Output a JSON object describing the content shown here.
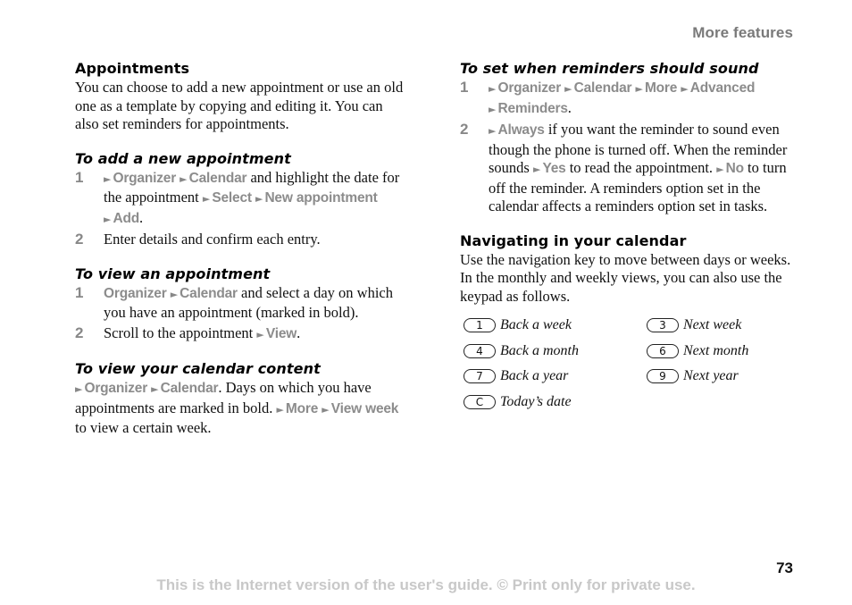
{
  "header": {
    "section_title": "More features"
  },
  "left": {
    "appointments": {
      "heading": "Appointments",
      "body": "You can choose to add a new appointment or use an old one as a template by copying and editing it. You can also set reminders for appointments."
    },
    "add_new": {
      "heading": "To add a new appointment",
      "steps": [
        {
          "num": "1",
          "m1": "Organizer",
          "m2": "Calendar",
          "t1": " and highlight the date for the appointment ",
          "m3": "Select",
          "m4": "New appointment",
          "m5": "Add",
          "t2": "."
        },
        {
          "num": "2",
          "text": "Enter details and confirm each entry."
        }
      ]
    },
    "view_appt": {
      "heading": "To view an appointment",
      "steps": [
        {
          "num": "1",
          "m1": "Organizer",
          "m2": "Calendar",
          "t1": " and select a day on which you have an appointment (marked in bold)."
        },
        {
          "num": "2",
          "t1": "Scroll to the appointment ",
          "m1": "View",
          "t2": "."
        }
      ]
    },
    "view_content": {
      "heading": "To view your calendar content",
      "m1": "Organizer",
      "m2": "Calendar",
      "t1": ". Days on which you have appointments are marked in bold. ",
      "m3": "More",
      "m4": "View week",
      "t2": " to view a certain week."
    }
  },
  "right": {
    "reminders": {
      "heading": "To set when reminders should sound",
      "steps": [
        {
          "num": "1",
          "m1": "Organizer",
          "m2": "Calendar",
          "m3": "More",
          "m4": "Advanced",
          "m5": "Reminders",
          "t1": "."
        },
        {
          "num": "2",
          "m1": "Always",
          "t1": " if you want the reminder to sound even though the phone is turned off. When the reminder sounds ",
          "m2": "Yes",
          "t2": " to read the appointment. ",
          "m3": "No",
          "t3": " to turn off the reminder. A reminders option set in the calendar affects a reminders option set in tasks."
        }
      ]
    },
    "navigating": {
      "heading": "Navigating in your calendar",
      "body": "Use the navigation key to move between days or weeks. In the monthly and weekly views, you can also use the keypad as follows.",
      "keys": [
        {
          "key": "1",
          "label": "Back a week"
        },
        {
          "key": "3",
          "label": "Next week"
        },
        {
          "key": "4",
          "label": "Back a month"
        },
        {
          "key": "6",
          "label": "Next month"
        },
        {
          "key": "7",
          "label": "Back a year"
        },
        {
          "key": "9",
          "label": "Next year"
        },
        {
          "key": "C",
          "label": "Today’s date"
        }
      ]
    }
  },
  "footer": {
    "page_number": "73",
    "notice": "This is the Internet version of the user's guide. © Print only for private use."
  },
  "icons": {
    "menu_arrow": "►"
  }
}
